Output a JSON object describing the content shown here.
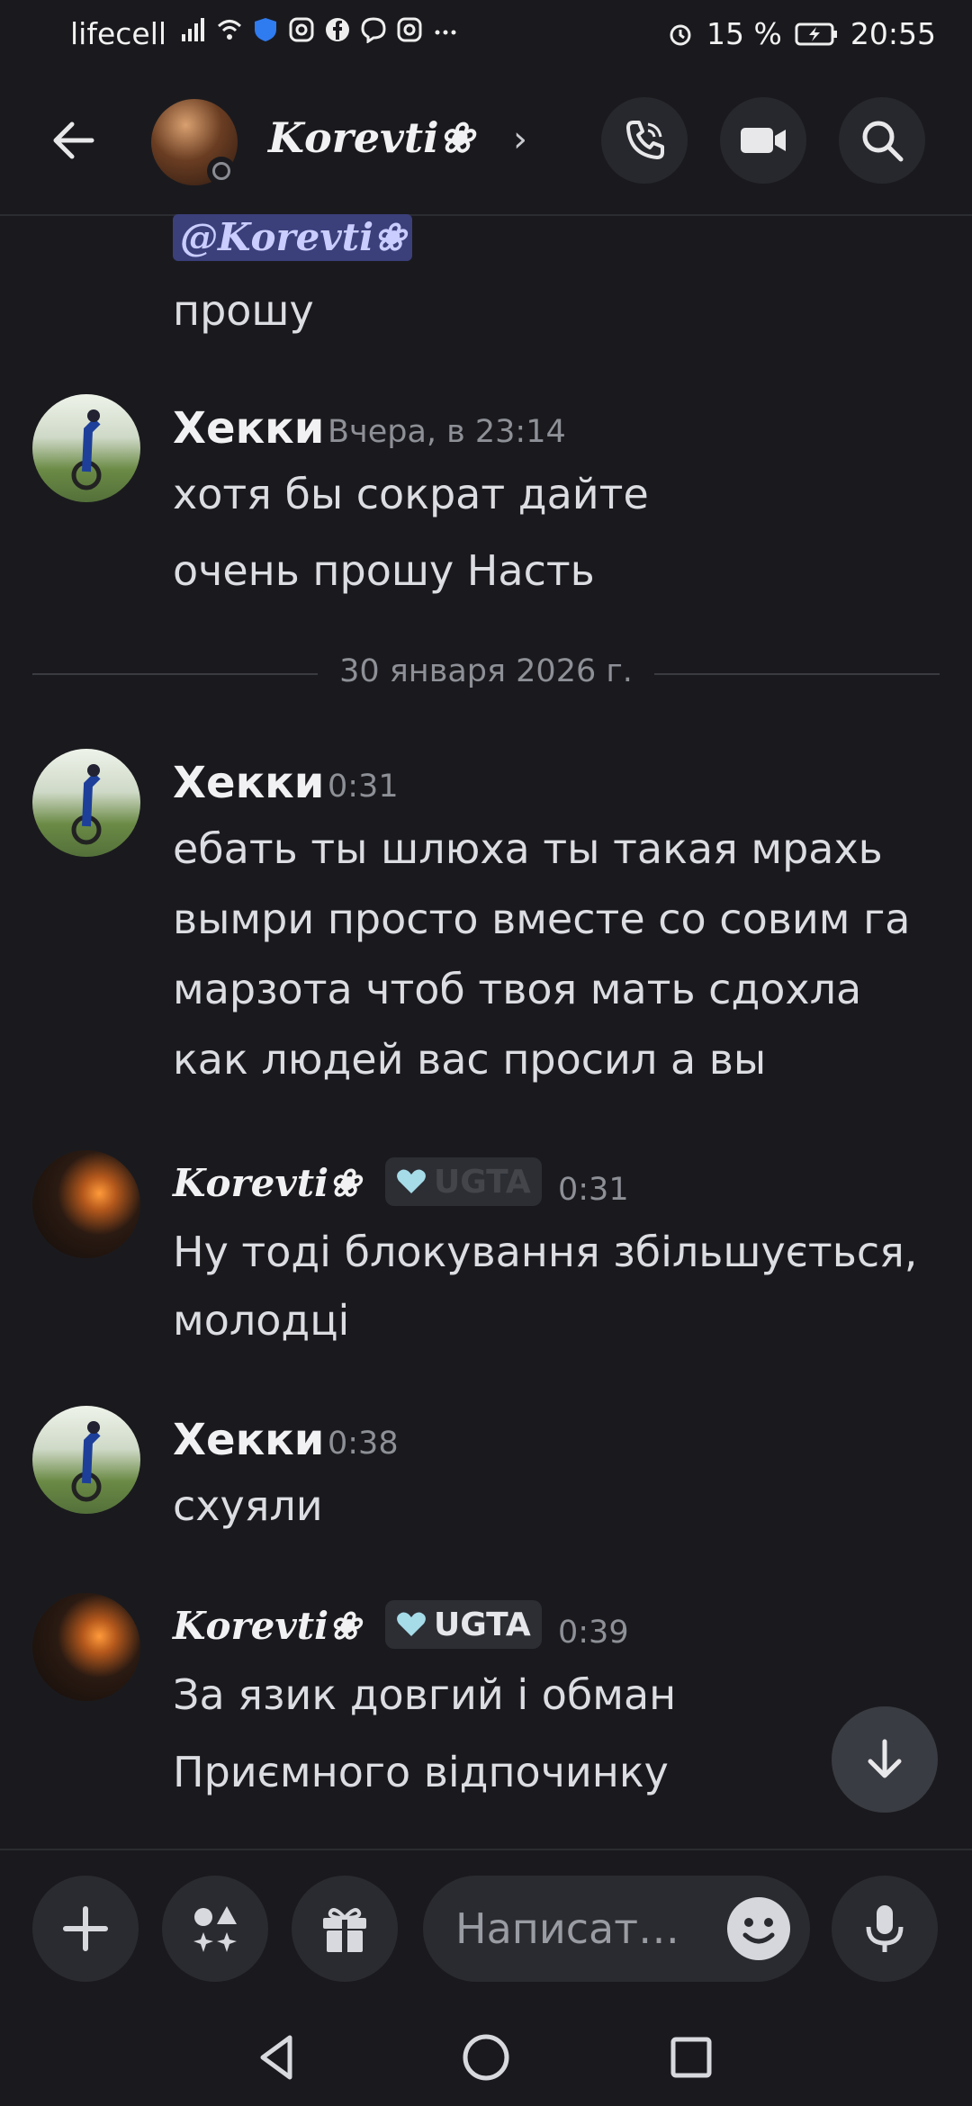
{
  "status": {
    "carrier": "lifecell",
    "battery": "15 %",
    "time": "20:55"
  },
  "header": {
    "contact_name": "𝑲𝒐𝒓𝒆𝒗𝒕𝒊❀",
    "chevron": "›"
  },
  "messages": {
    "mention": "@𝑲𝒐𝒓𝒆𝒗𝒕𝒊❀",
    "m0_line1": "прошу",
    "m1": {
      "user": "Хекки",
      "time": "Вчера, в 23:14",
      "line1": "хотя бы сократ дайте",
      "line2": "очень прошу Насть"
    },
    "divider": "30 января 2026 г.",
    "m2": {
      "user": "Хекки",
      "time": "0:31",
      "line1": "ебать ты шлюха ты такая мрахь",
      "line2": "вымри просто вместе со совим га",
      "line3": "марзота чтоб твоя мать сдохла",
      "line4": "как людей вас просил а вы"
    },
    "m3": {
      "user": "𝑲𝒐𝒓𝒆𝒗𝒕𝒊❀",
      "tag": "UGTA",
      "time": "0:31",
      "line1": "Ну тоді блокування збільшується,",
      "line2": "молодці"
    },
    "m4": {
      "user": "Хекки",
      "time": "0:38",
      "line1": "схуяли"
    },
    "m5": {
      "user": "𝑲𝒐𝒓𝒆𝒗𝒕𝒊❀",
      "tag": "UGTA",
      "time": "0:39",
      "line1": "За язик довгий і обман",
      "line2": "Приємного відпочинку"
    }
  },
  "composer": {
    "placeholder": "Написат…"
  },
  "colors": {
    "background": "#1a1a1e",
    "mention_bg": "#3b3f7a",
    "tag_heart": "#a6dbe8"
  }
}
